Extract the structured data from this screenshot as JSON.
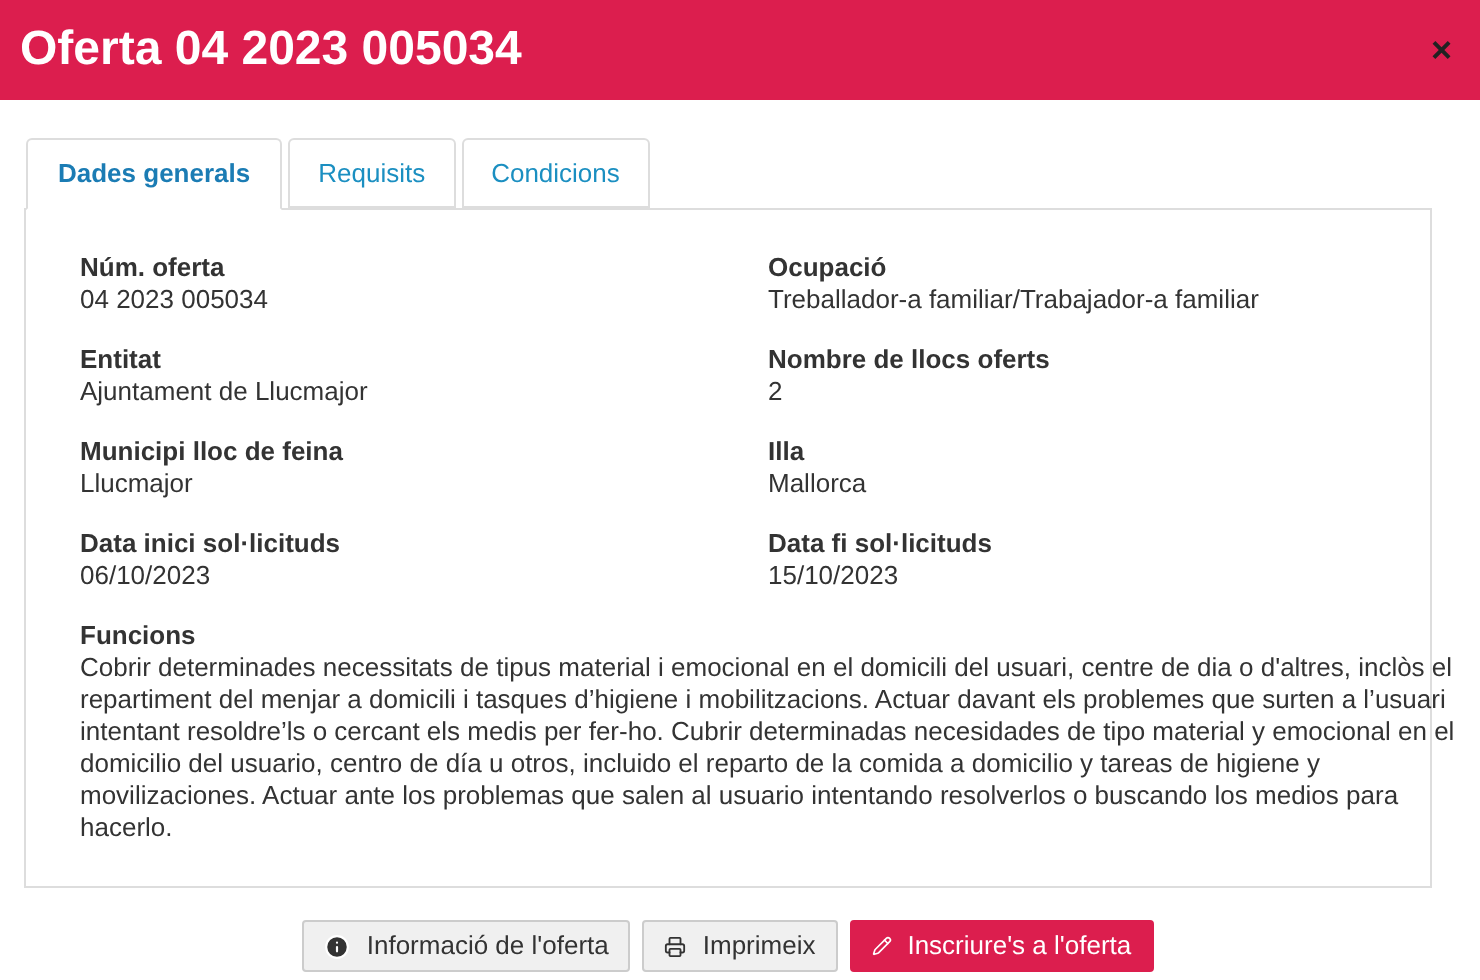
{
  "window": {
    "title": "Oferta 04 2023 005034",
    "close": "×"
  },
  "tabs": [
    {
      "label": "Dades generals",
      "selected": true
    },
    {
      "label": "Requisits",
      "selected": false
    },
    {
      "label": "Condicions",
      "selected": false
    }
  ],
  "fields": [
    {
      "label": "Núm. oferta",
      "value": "04 2023 005034"
    },
    {
      "label": "Ocupació",
      "value": "Treballador-a familiar/Trabajador-a familiar"
    },
    {
      "label": "Entitat",
      "value": "Ajuntament de Llucmajor"
    },
    {
      "label": "Nombre de llocs oferts",
      "value": "2"
    },
    {
      "label": "Municipi lloc de feina",
      "value": "Llucmajor"
    },
    {
      "label": "Illa",
      "value": "Mallorca"
    },
    {
      "label": "Data inici sol·licituds",
      "value": "06/10/2023"
    },
    {
      "label": "Data fi sol·licituds",
      "value": "15/10/2023"
    }
  ],
  "functions": {
    "label": "Funcions",
    "text": "Cobrir determinades necessitats de tipus material i emocional en el domicili del usuari, centre de dia o d'altres, inclòs el repartiment del menjar a domicili i tasques d’higiene i mobilitzacions. Actuar davant els problemes que surten a l’usuari intentant resoldre’ls o cercant els medis per fer-ho. Cubrir determinadas necesidades de tipo material y emocional en el domicilio del usuario, centro de día u otros, incluido el reparto de la comida a domicilio y tareas de higiene y movilizaciones. Actuar ante los problemas que salen al usuario intentando resolverlos o buscando los medios para hacerlo."
  },
  "buttons": [
    {
      "kind": "info",
      "label": "Informació de l'oferta"
    },
    {
      "kind": "print",
      "label": "Imprimeix"
    },
    {
      "kind": "primary",
      "label": "Inscriure's a l'oferta"
    }
  ]
}
